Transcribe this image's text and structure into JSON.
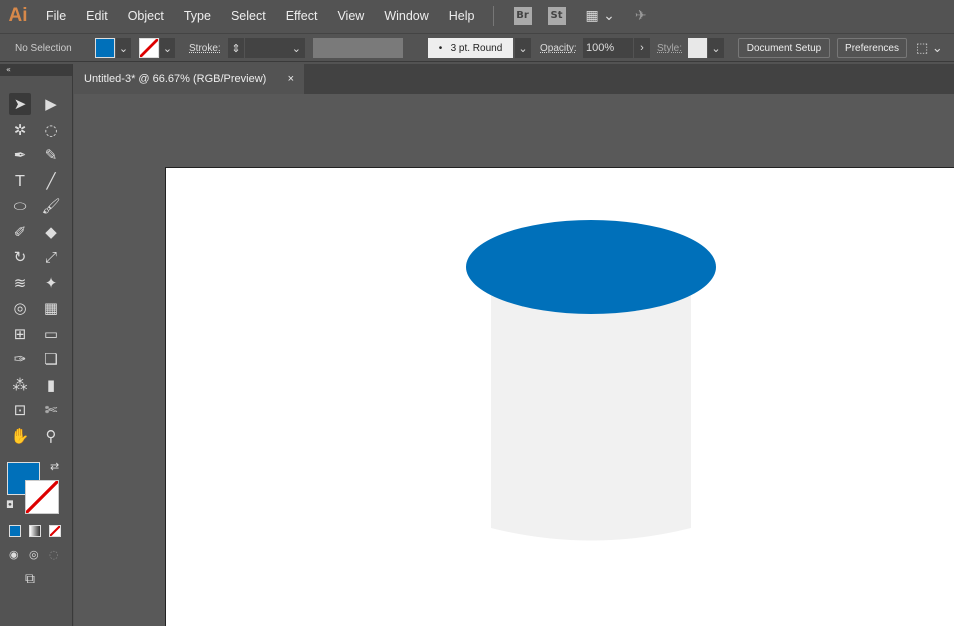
{
  "app": {
    "logo": "Ai"
  },
  "menu": [
    "File",
    "Edit",
    "Object",
    "Type",
    "Select",
    "Effect",
    "View",
    "Window",
    "Help"
  ],
  "bridge": [
    "Br",
    "St"
  ],
  "control": {
    "selection": "No Selection",
    "fill_color": "#0070BA",
    "stroke_label": "Stroke:",
    "brush": "3 pt. Round",
    "opacity_label": "Opacity:",
    "opacity": "100%",
    "style_label": "Style:",
    "doc_setup": "Document Setup",
    "preferences": "Preferences"
  },
  "tab": {
    "title": "Untitled-3* @ 66.67% (RGB/Preview)",
    "close": "×"
  },
  "tools": [
    {
      "name": "selection-tool",
      "glyph": "➤"
    },
    {
      "name": "direct-selection-tool",
      "glyph": "▶"
    },
    {
      "name": "magic-wand-tool",
      "glyph": "✲"
    },
    {
      "name": "lasso-tool",
      "glyph": "◌"
    },
    {
      "name": "pen-tool",
      "glyph": "✒"
    },
    {
      "name": "curvature-tool",
      "glyph": "✎"
    },
    {
      "name": "type-tool",
      "glyph": "T"
    },
    {
      "name": "line-tool",
      "glyph": "╱"
    },
    {
      "name": "ellipse-tool",
      "glyph": "⬭"
    },
    {
      "name": "paintbrush-tool",
      "glyph": "🖌"
    },
    {
      "name": "shaper-tool",
      "glyph": "✐"
    },
    {
      "name": "eraser-tool",
      "glyph": "◆"
    },
    {
      "name": "rotate-tool",
      "glyph": "↻"
    },
    {
      "name": "scale-tool",
      "glyph": "⤢"
    },
    {
      "name": "warp-tool",
      "glyph": "≋"
    },
    {
      "name": "puppet-warp-tool",
      "glyph": "✦"
    },
    {
      "name": "shape-builder-tool",
      "glyph": "◎"
    },
    {
      "name": "perspective-grid-tool",
      "glyph": "▦"
    },
    {
      "name": "mesh-tool",
      "glyph": "⊞"
    },
    {
      "name": "gradient-tool",
      "glyph": "▭"
    },
    {
      "name": "eyedropper-tool",
      "glyph": "✑"
    },
    {
      "name": "blend-tool",
      "glyph": "❏"
    },
    {
      "name": "symbol-sprayer-tool",
      "glyph": "⁂"
    },
    {
      "name": "column-graph-tool",
      "glyph": "▮"
    },
    {
      "name": "artboard-tool",
      "glyph": "⊡"
    },
    {
      "name": "slice-tool",
      "glyph": "✄"
    },
    {
      "name": "hand-tool",
      "glyph": "✋"
    },
    {
      "name": "zoom-tool",
      "glyph": "⚲"
    }
  ],
  "colors": {
    "ellipse_top": "#0070BA",
    "cylinder_body": "#F1F1F1",
    "fill": "#0070BA"
  }
}
